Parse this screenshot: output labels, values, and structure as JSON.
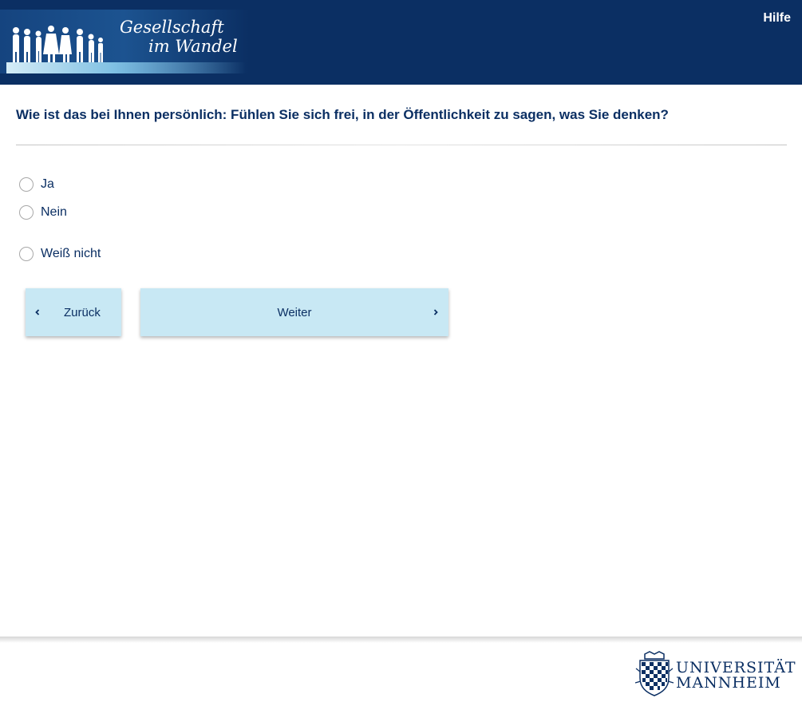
{
  "header": {
    "logo_line1": "Gesellschaft",
    "logo_line2": "im Wandel",
    "help_label": "Hilfe"
  },
  "question": {
    "text": "Wie ist das bei Ihnen persönlich: Fühlen Sie sich frei, in der Öffentlichkeit zu sagen, was Sie denken?"
  },
  "options": [
    {
      "label": "Ja"
    },
    {
      "label": "Nein"
    },
    {
      "label": "Weiß nicht"
    }
  ],
  "nav": {
    "back_label": "Zurück",
    "next_label": "Weiter"
  },
  "footer": {
    "uni_line1": "UNIVERSITÄT",
    "uni_line2": "MANNHEIM"
  },
  "colors": {
    "header_bg": "#0b2f63",
    "text_primary": "#0b2f63",
    "button_bg": "#c8e8f4"
  }
}
